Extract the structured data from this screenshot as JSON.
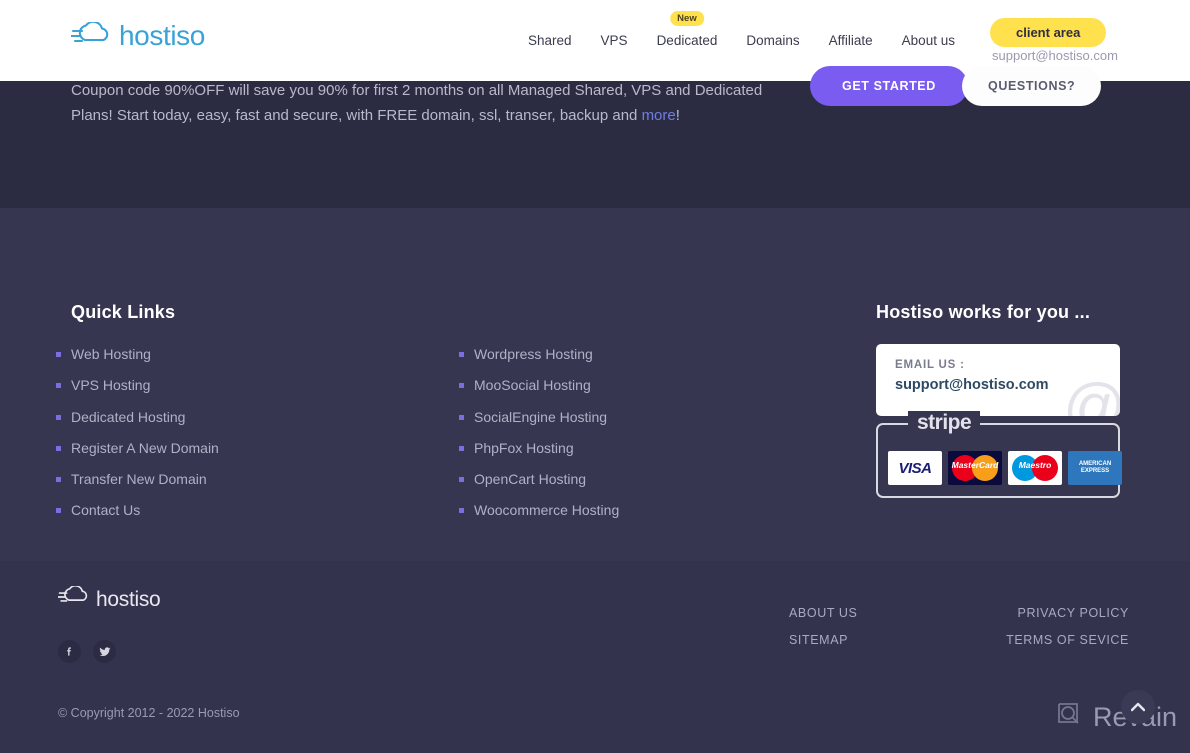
{
  "header": {
    "logo_text": "hostiso",
    "logo_icon": "cloud-speed-icon",
    "nav": [
      {
        "label": "Shared",
        "badge": null
      },
      {
        "label": "VPS",
        "badge": null
      },
      {
        "label": "Dedicated",
        "badge": "New"
      },
      {
        "label": "Domains",
        "badge": null
      },
      {
        "label": "Affiliate",
        "badge": null
      },
      {
        "label": "About us",
        "badge": null
      }
    ],
    "client_area_label": "client area",
    "support_email": "support@hostiso.com"
  },
  "promo": {
    "line1": "Coupon code 90%OFF will save you 90% for first 2 months on all Managed Shared, VPS and",
    "line2": "Dedicated Plans! Start today, easy, fast and secure, with FREE domain, ssl, transer, backup and ",
    "more_label": "more",
    "line2_end": "!",
    "get_started_label": "GET STARTED",
    "questions_label": "QUESTIONS?"
  },
  "footer": {
    "quick_links_title": "Quick Links",
    "links_column_1": [
      "Web Hosting",
      "VPS Hosting",
      "Dedicated Hosting",
      "Register A New Domain",
      "Transfer New Domain",
      "Contact Us"
    ],
    "links_column_2": [
      "Wordpress Hosting",
      "MooSocial Hosting",
      "SocialEngine Hosting",
      "PhpFox Hosting",
      "OpenCart Hosting",
      "Woocommerce Hosting"
    ],
    "works_title": "Hostiso works for you ...",
    "email_label": "EMAIL US :",
    "email_value": "support@hostiso.com",
    "email_watermark": "@",
    "payment": {
      "provider": "stripe",
      "cards": [
        "VISA",
        "MasterCard",
        "Maestro",
        "AMERICAN EXPRESS"
      ]
    },
    "bottom_logo_text": "hostiso",
    "socials": [
      {
        "name": "facebook-icon",
        "glyph": "f"
      },
      {
        "name": "twitter-icon",
        "glyph": "t"
      }
    ],
    "bottom_links": [
      "ABOUT US",
      "PRIVACY POLICY",
      "SITEMAP",
      "TERMS OF SEVICE"
    ],
    "copyright": "© Copyright 2012 - 2022 Hostiso"
  },
  "watermark": {
    "brand": "Revain",
    "icon": "revain-logo-icon",
    "scroll_top_icon": "chevron-up-icon"
  },
  "colors": {
    "nav_bg": "#ffffff",
    "promo_bg": "#2b2b42",
    "footer_bg": "#363651",
    "footer_bottom_bg": "#33334e",
    "accent_yellow": "#ffe14d",
    "accent_purple": "#7a5cf0",
    "logo_blue": "#39a3d8",
    "bullet": "#7b6fe0"
  }
}
